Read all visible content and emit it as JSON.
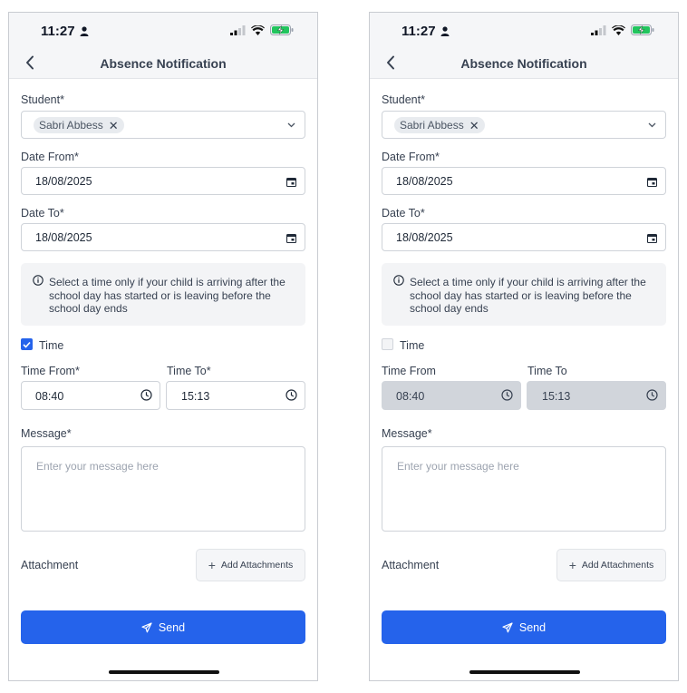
{
  "screens": [
    {
      "status": {
        "time": "11:27"
      },
      "header": {
        "title": "Absence Notification"
      },
      "form": {
        "student_label": "Student*",
        "student_chip": "Sabri Abbess",
        "date_from_label": "Date From*",
        "date_from_value": "18/08/2025",
        "date_to_label": "Date To*",
        "date_to_value": "18/08/2025",
        "info_text": "Select a time only if your child is arriving after the school day has started or is leaving before the school day ends",
        "time_checkbox_label": "Time",
        "time_checked": true,
        "time_from_label": "Time From*",
        "time_from_value": "08:40",
        "time_to_label": "Time To*",
        "time_to_value": "15:13",
        "message_label": "Message*",
        "message_placeholder": "Enter your message here",
        "attachment_label": "Attachment",
        "add_attachments_label": "Add Attachments",
        "send_label": "Send"
      }
    },
    {
      "status": {
        "time": "11:27"
      },
      "header": {
        "title": "Absence Notification"
      },
      "form": {
        "student_label": "Student*",
        "student_chip": "Sabri Abbess",
        "date_from_label": "Date From*",
        "date_from_value": "18/08/2025",
        "date_to_label": "Date To*",
        "date_to_value": "18/08/2025",
        "info_text": "Select a time only if your child is arriving after the school day has started or is leaving before the school day ends",
        "time_checkbox_label": "Time",
        "time_checked": false,
        "time_from_label": "Time From",
        "time_from_value": "08:40",
        "time_to_label": "Time To",
        "time_to_value": "15:13",
        "message_label": "Message*",
        "message_placeholder": "Enter your message here",
        "attachment_label": "Attachment",
        "add_attachments_label": "Add Attachments",
        "send_label": "Send"
      }
    }
  ],
  "colors": {
    "accent": "#2563eb",
    "battery": "#22c55e",
    "disabled_field": "#d1d5db"
  }
}
